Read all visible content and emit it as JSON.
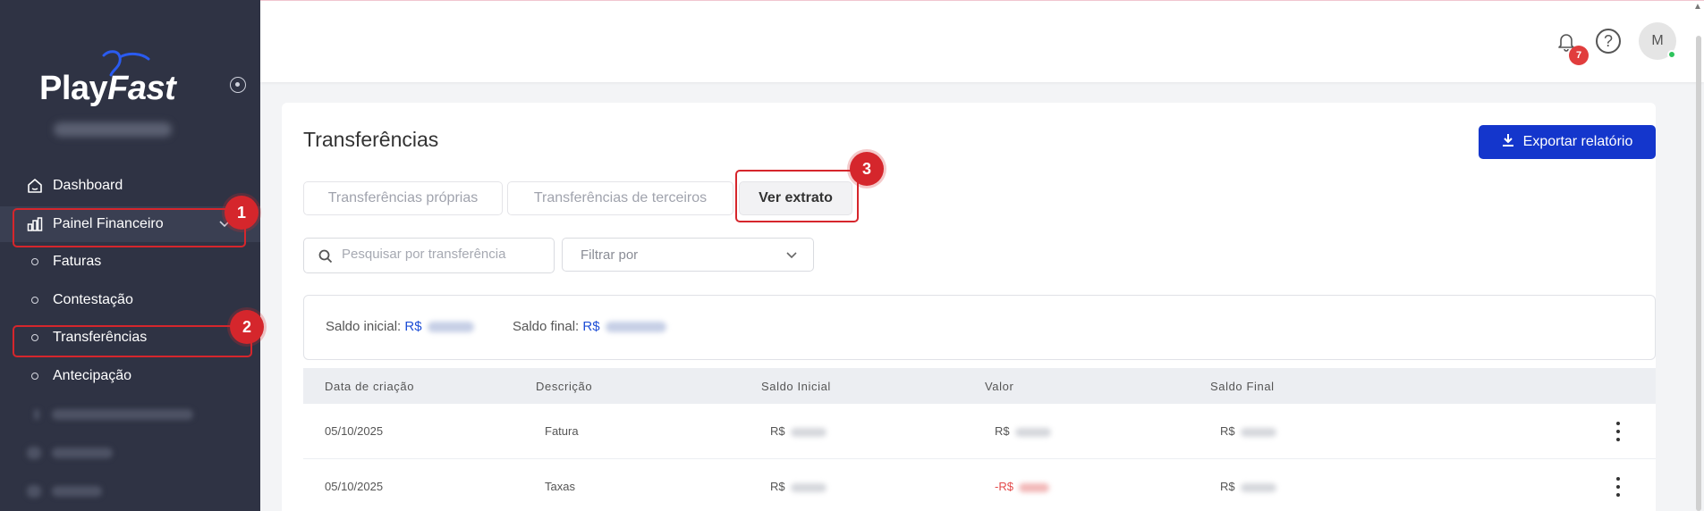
{
  "brand": {
    "name_plain": "Play",
    "name_italic": "Fast"
  },
  "sidebar": {
    "items": [
      {
        "label": "Dashboard",
        "icon": "home-icon"
      },
      {
        "label": "Painel Financeiro",
        "icon": "bar-chart-icon"
      },
      {
        "label": "Faturas"
      },
      {
        "label": "Contestação"
      },
      {
        "label": "Transferências"
      },
      {
        "label": "Antecipação"
      }
    ]
  },
  "annotations": {
    "one": "1",
    "two": "2",
    "three": "3"
  },
  "header": {
    "notification_count": "7",
    "help_symbol": "?",
    "avatar_initial": "M"
  },
  "page": {
    "title": "Transferências",
    "export_label": "Exportar relatório",
    "tabs": [
      {
        "label": "Transferências próprias"
      },
      {
        "label": "Transferências de terceiros"
      },
      {
        "label": "Ver extrato"
      }
    ],
    "search_placeholder": "Pesquisar por transferência",
    "filter_placeholder": "Filtrar por"
  },
  "balances": {
    "initial_label": "Saldo inicial:",
    "final_label": "Saldo final:",
    "currency": "R$"
  },
  "table": {
    "columns": [
      "Data de criação",
      "Descrição",
      "Saldo Inicial",
      "Valor",
      "Saldo Final"
    ],
    "rows": [
      {
        "date": "05/10/2025",
        "description": "Fatura",
        "saldo_inicial_cur": "R$",
        "valor_cur": "R$",
        "saldo_final_cur": "R$"
      },
      {
        "date": "05/10/2025",
        "description": "Taxas",
        "saldo_inicial_cur": "R$",
        "valor_cur": "-R$",
        "saldo_final_cur": "R$"
      }
    ]
  },
  "colors": {
    "sidebar_bg": "#2f3344",
    "primary": "#1436cc",
    "annotation_red": "#d5262c",
    "negative": "#e34a4a"
  }
}
